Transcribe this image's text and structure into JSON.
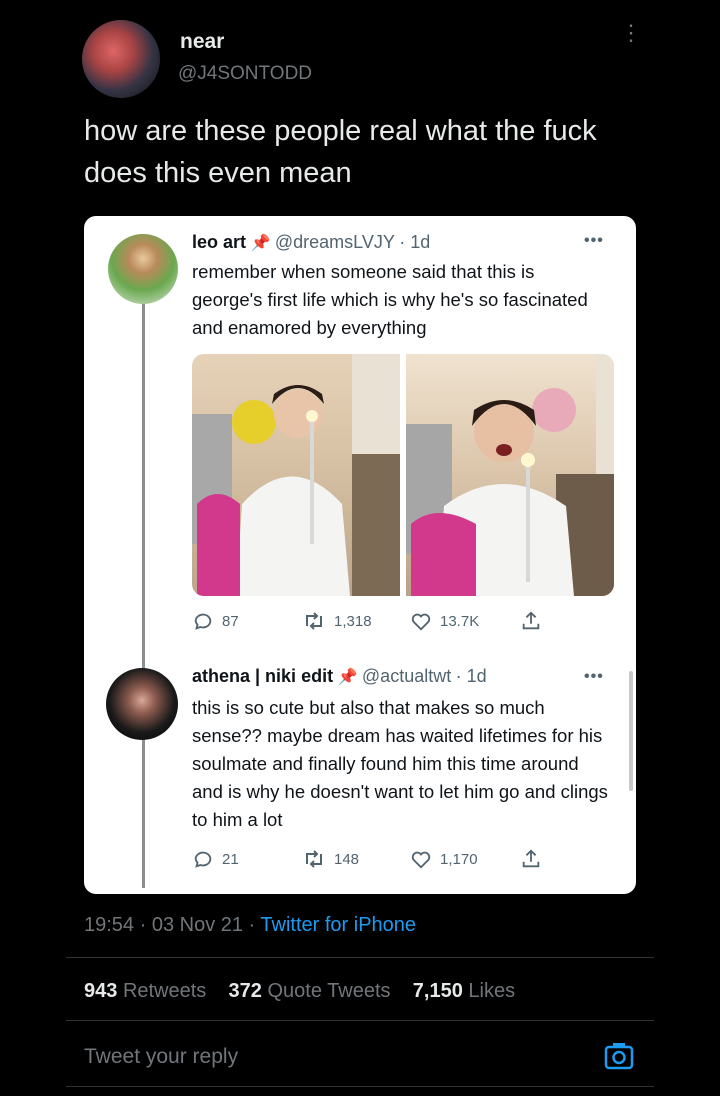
{
  "author": {
    "name": "near",
    "handle": "@J4SONTODD"
  },
  "tweet": {
    "text": "how are these people real what the fuck does this even mean"
  },
  "quoted": [
    {
      "name": "leo art",
      "handle": "@dreamsLVJY",
      "time": "· 1d",
      "text": "remember when someone said that this is george's first life which is why he's so fascinated and enamored by everything",
      "stats": {
        "replies": "87",
        "retweets": "1,318",
        "likes": "13.7K"
      }
    },
    {
      "name": "athena | niki edit",
      "handle": "@actualtwt",
      "time": "· 1d",
      "text": "this is so cute but also that makes so much sense?? maybe dream has waited lifetimes for his soulmate and finally found him this time around and is why he doesn't want to let him go and clings to him a lot",
      "stats": {
        "replies": "21",
        "retweets": "148",
        "likes": "1,170"
      }
    }
  ],
  "meta": {
    "time": "19:54 · 03 Nov 21 ·",
    "client": "Twitter for iPhone"
  },
  "stats": {
    "retweets_num": "943",
    "retweets_label": "Retweets",
    "quotes_num": "372",
    "quotes_label": "Quote Tweets",
    "likes_num": "7,150",
    "likes_label": "Likes"
  },
  "reply": {
    "placeholder": "Tweet your reply"
  },
  "colors": {
    "background": "#000000",
    "card": "#ffffff",
    "link": "#1d9bf0",
    "pin": "#d61d2a"
  }
}
